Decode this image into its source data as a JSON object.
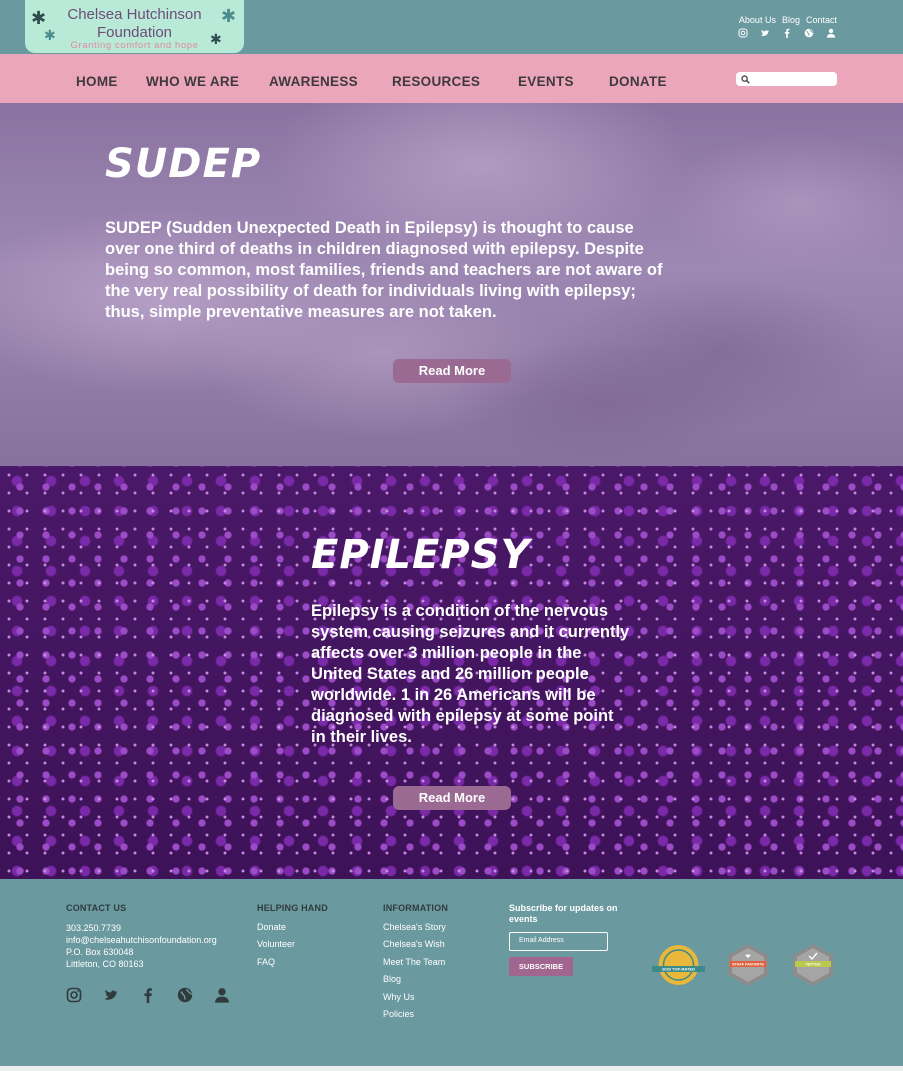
{
  "header": {
    "logo": {
      "line1": "Chelsea Hutchinson",
      "line2": "Foundation",
      "tagline": "Granting comfort and hope"
    },
    "top_links": [
      "About Us",
      "Blog",
      "Contact"
    ],
    "top_icons": [
      "instagram-icon",
      "twitter-icon",
      "facebook-icon",
      "globe-icon",
      "user-icon"
    ]
  },
  "nav": {
    "items": [
      "HOME",
      "WHO WE ARE",
      "AWARENESS",
      "RESOURCES",
      "EVENTS",
      "DONATE"
    ],
    "search_placeholder": ""
  },
  "sudep": {
    "title": "SUDEP",
    "text": "SUDEP (Sudden Unexpected Death in Epilepsy) is thought to cause over one third of deaths in children diagnosed with epilepsy. Despite being so common, most families, friends and teachers are not aware of the very real possibility of death for individuals living with epilepsy; thus, simple preventative measures are not taken.",
    "button": "Read More"
  },
  "epilepsy": {
    "title": "EPILEPSY",
    "text": "Epilepsy is a condition of the nervous system causing seizures and it currently affects over 3 million people in the United States and 26 million people worldwide.  1 in 26 Americans will be diagnosed with epilepsy at some point in their lives.",
    "button": "Read More"
  },
  "footer": {
    "contact": {
      "heading": "CONTACT US",
      "phone": "303.250.7739",
      "email": "info@chelseahutchisonfoundation.org",
      "address1": "P.O. Box 630048",
      "address2": "Littleton, CO 80163"
    },
    "helping": {
      "heading": "HELPING HAND",
      "links": [
        "Donate",
        "Volunteer",
        "FAQ"
      ]
    },
    "information": {
      "heading": "INFORMATION",
      "links": [
        "Chelsea's Story",
        "Chelsea's Wish",
        "Meet The Team",
        "Blog",
        "Why Us",
        "Policies"
      ]
    },
    "subscribe": {
      "heading": "Subscribe for updates on events",
      "email_placeholder": "Email Address",
      "button": "SUBSCRIBE"
    },
    "badges": [
      {
        "name": "2020 TOP-RATED",
        "color": "#e9b73a"
      },
      {
        "name": "STAFF FAVORITE",
        "color": "#e0603c"
      },
      {
        "name": "VETTED",
        "color": "#b9c94e"
      }
    ]
  },
  "colors": {
    "topbar": "#6b99a0",
    "nav": "#eca6bb",
    "logo_bg": "#b9ead8",
    "button": "#9a6a93",
    "footer": "#6b99a0"
  }
}
